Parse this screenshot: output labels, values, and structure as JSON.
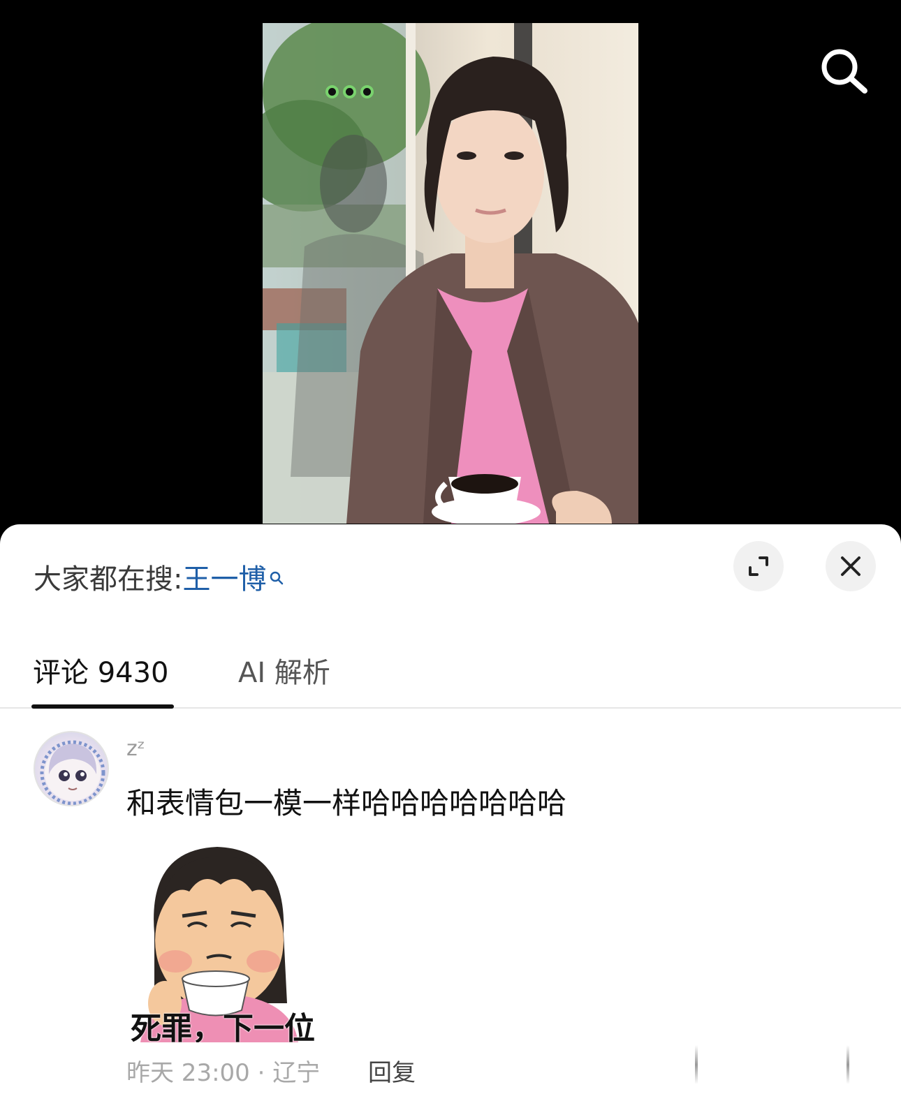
{
  "hot_search": {
    "prefix": "大家都在搜:",
    "keyword": "王一博"
  },
  "tabs": [
    {
      "label": "评论 9430",
      "active": true
    },
    {
      "label": "AI 解析",
      "active": false
    }
  ],
  "comment": {
    "username": "zᶻ",
    "text": "和表情包一模一样哈哈哈哈哈哈哈",
    "sticker_caption": "死罪，下一位",
    "time_location": "昨天 23:00 · 辽宁",
    "reply_label": "回复"
  },
  "icons": {
    "top_search": "search-icon",
    "expand": "expand-icon",
    "close": "close-icon",
    "keyword_search": "small-search-icon"
  },
  "colors": {
    "keyword": "#1f5fa8",
    "sheet_bg": "#ffffff",
    "video_bg": "#000000"
  }
}
